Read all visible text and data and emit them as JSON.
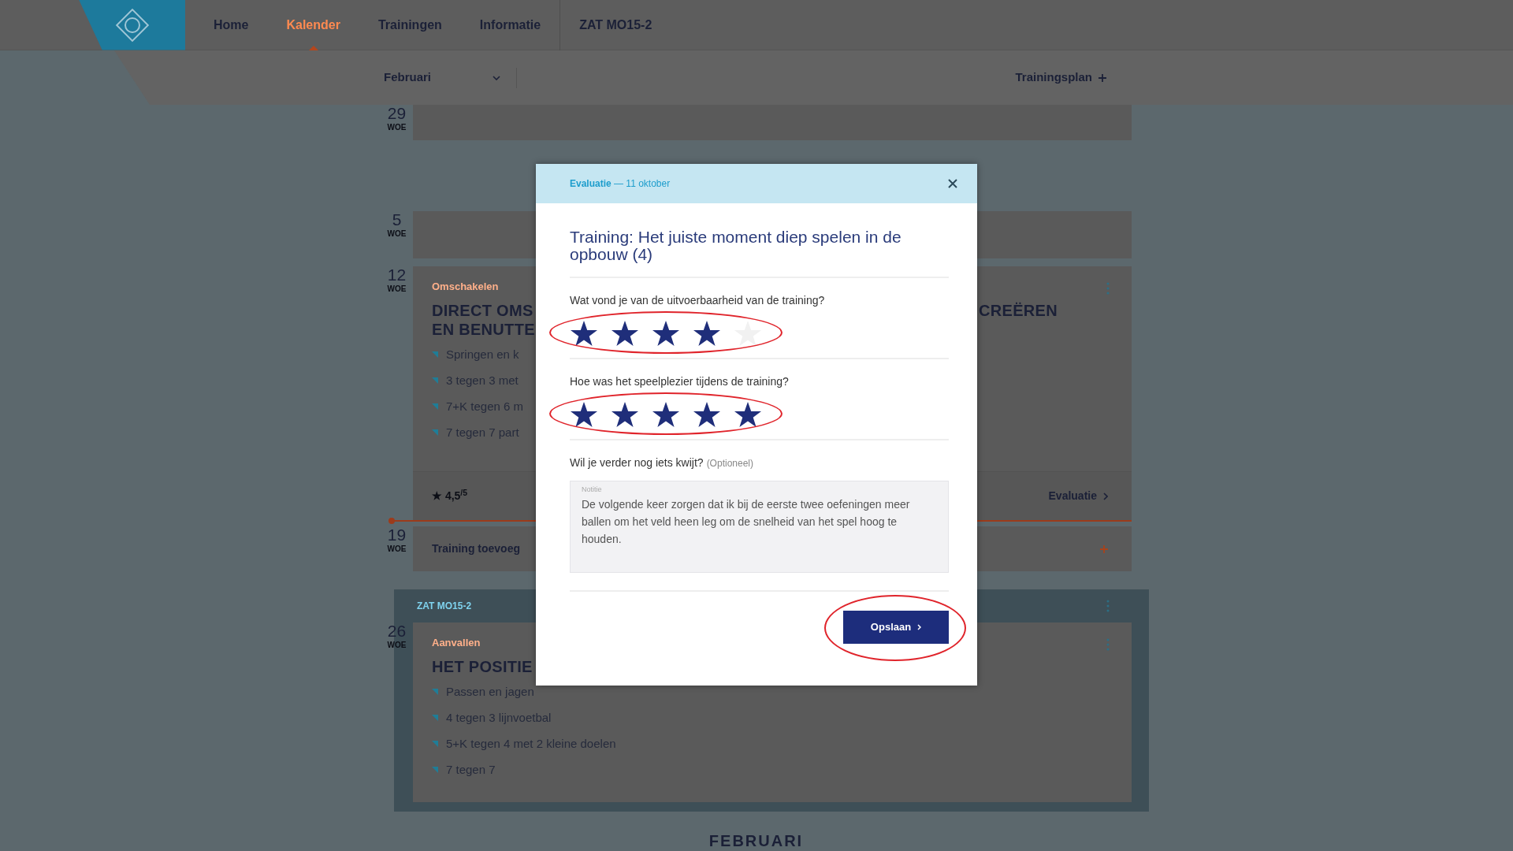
{
  "nav": {
    "items": [
      {
        "label": "Home",
        "selected": false
      },
      {
        "label": "Kalender",
        "selected": true
      },
      {
        "label": "Trainingen",
        "selected": false
      },
      {
        "label": "Informatie",
        "selected": false
      }
    ],
    "team": "ZAT MO15-2"
  },
  "toolbar": {
    "month": "Februari",
    "action": "Trainingsplan"
  },
  "weeks": [
    {
      "kind": "empty",
      "day": "29",
      "weekday": "WOE"
    },
    {
      "kind": "empty",
      "day": "5",
      "weekday": "WOE"
    },
    {
      "kind": "training",
      "day": "12",
      "weekday": "WOE",
      "category": "Omschakelen",
      "title_left": [
        "DIRECT OMS",
        "EN BENUTTE"
      ],
      "title_right": "CREËREN",
      "exercises": [
        "Springen en k",
        "3 tegen 3 met",
        "7+K tegen 6 m",
        "7 tegen 7 part"
      ],
      "rating": "★ 4,5$^{/5}$",
      "footer_link": "Evaluatie"
    },
    {
      "kind": "add",
      "day": "19",
      "weekday": "WOE",
      "label": "Training toevoeg",
      "today": true
    },
    {
      "kind": "team",
      "team": "ZAT MO15-2",
      "day": "26",
      "weekday": "WOE",
      "category": "Aanvallen",
      "title_left": [
        "HET POSITIE"
      ],
      "exercises": [
        "Passen en jagen",
        "4 tegen 3 lijnvoetbal",
        "5+K tegen 4 met 2 kleine doelen",
        "7 tegen 7"
      ]
    }
  ],
  "section_heading": "FEBRUARI",
  "modal": {
    "header": "**Evaluatie** — 11 oktober",
    "title": "Training: Het juiste moment diep spelen in de opbouw (4)",
    "ratings": [
      {
        "question": "Wat vond je van de uitvoerbaarheid van de training?",
        "stars": 4,
        "highlighted": true
      },
      {
        "question": "Hoe was het speelplezier tijdens de training?",
        "stars": 5,
        "highlighted": true
      }
    ],
    "note": {
      "question": "Wil je verder nog iets kwijt?",
      "hint": "(Optioneel)",
      "label": "Notitie",
      "value": "De volgende keer zorgen dat ik bij de eerste twee oefeningen meer ballen om het veld heen leg om de snelheid van het spel hoog te houden."
    },
    "save": {
      "label": "Opslaan",
      "highlighted": true
    }
  }
}
